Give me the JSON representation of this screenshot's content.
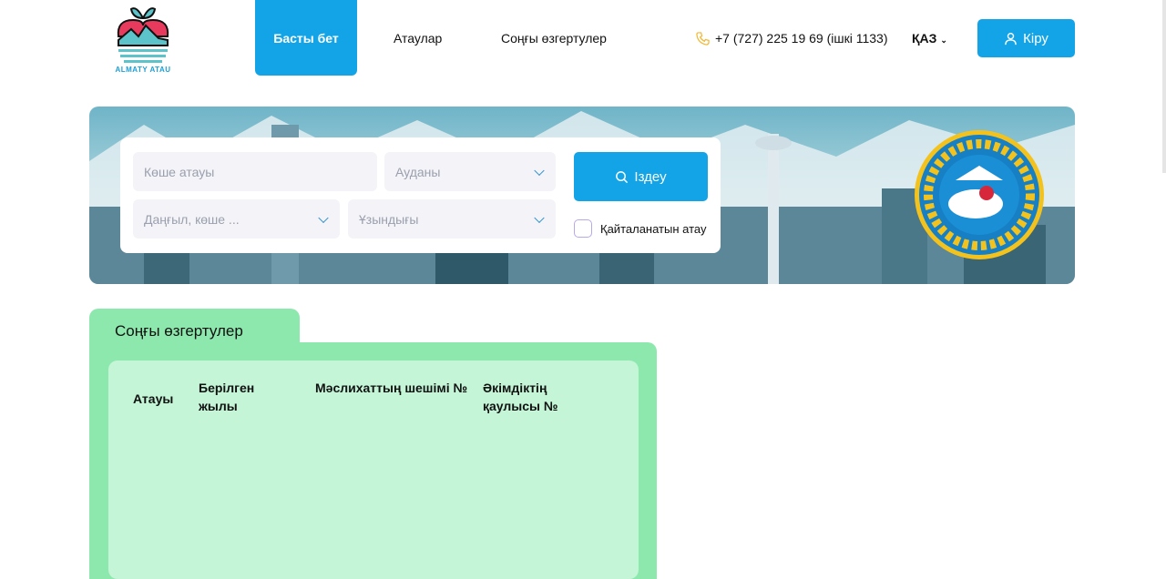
{
  "logo": {
    "text": "ALMATY ATAU"
  },
  "nav": {
    "home": "Басты бет",
    "names": "Атаулар",
    "changes": "Соңғы өзгертулер"
  },
  "phone": "+7 (727) 225 19 69 (ішкі 1133)",
  "lang": "ҚАЗ",
  "login": "Кіру",
  "search": {
    "street_placeholder": "Көше атауы",
    "district": "Ауданы",
    "type": "Даңғыл, көше ...",
    "length": "Ұзындығы",
    "button": "Іздеу",
    "repeat_label": "Қайталанатын атау"
  },
  "recent": {
    "title": "Соңғы өзгертулер",
    "columns": [
      "Атауы",
      "Берілген жылы",
      "Мәслихаттың шешімі №",
      "Әкімдіктің қаулысы №"
    ]
  },
  "colors": {
    "primary": "#13a4e8",
    "green": "#8de8ad",
    "light_green": "#c3f5d6"
  }
}
